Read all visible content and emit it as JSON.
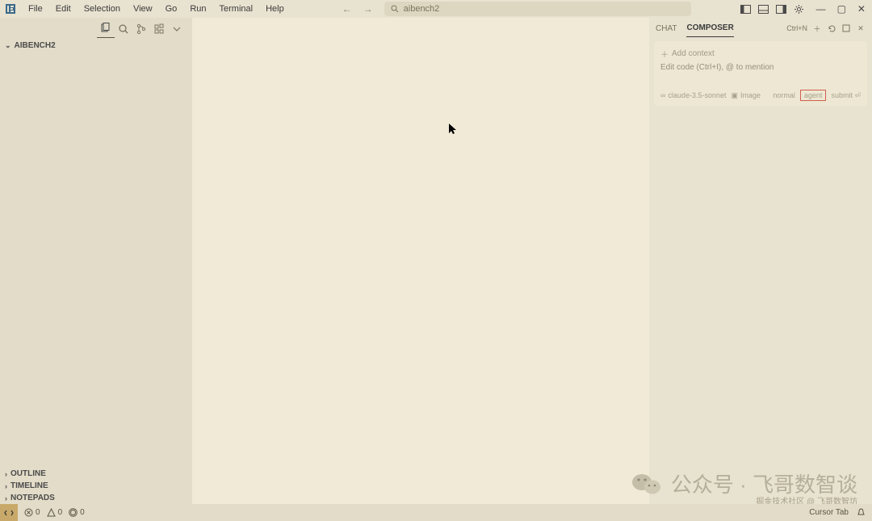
{
  "menu": {
    "items": [
      "File",
      "Edit",
      "Selection",
      "View",
      "Go",
      "Run",
      "Terminal",
      "Help"
    ]
  },
  "search": {
    "text": "aibench2"
  },
  "explorer": {
    "title": "AIBENCH2"
  },
  "side_sections": {
    "outline": "OUTLINE",
    "timeline": "TIMELINE",
    "notepads": "NOTEPADS"
  },
  "right_panel": {
    "tabs": {
      "chat": "CHAT",
      "composer": "COMPOSER"
    },
    "shortcut": "Ctrl+N",
    "add_context": "Add context",
    "placeholder": "Edit code (Ctrl+I), @ to mention",
    "model": "claude-3.5-sonnet",
    "image": "Image",
    "normal": "normal",
    "agent": "agent",
    "submit": "submit ⏎"
  },
  "status": {
    "errors": "0",
    "warnings": "0",
    "ports": "0",
    "cursor_tab": "Cursor Tab"
  },
  "watermark": {
    "label": "公众号 · 飞哥数智谈",
    "sub": "掘金技术社区 @ 飞哥数智坊"
  }
}
